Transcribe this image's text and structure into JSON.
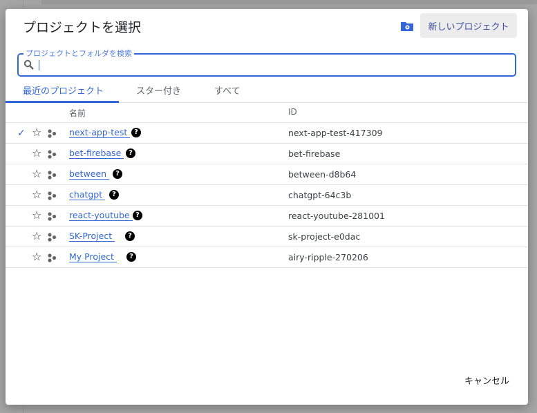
{
  "title": "プロジェクトを選択",
  "new_project_label": "新しいプロジェクト",
  "search": {
    "label": "プロジェクトとフォルダを検索",
    "value": ""
  },
  "tabs": [
    {
      "label": "最近のプロジェクト",
      "active": true
    },
    {
      "label": "スター付き"
    },
    {
      "label": "すべて"
    }
  ],
  "columns": {
    "name": "名前",
    "id": "ID"
  },
  "projects": [
    {
      "name": "next-app-test",
      "id": "next-app-test-417309",
      "selected": true
    },
    {
      "name": "bet-firebase",
      "id": "bet-firebase"
    },
    {
      "name": "between",
      "id": "between-d8b64"
    },
    {
      "name": "chatgpt",
      "id": "chatgpt-64c3b"
    },
    {
      "name": "react-youtube",
      "id": "react-youtube-281001"
    },
    {
      "name": "SK-Project",
      "id": "sk-project-e0dac"
    },
    {
      "name": "My Project",
      "id": "airy-ripple-270206"
    }
  ],
  "cancel_label": "キャンセル"
}
